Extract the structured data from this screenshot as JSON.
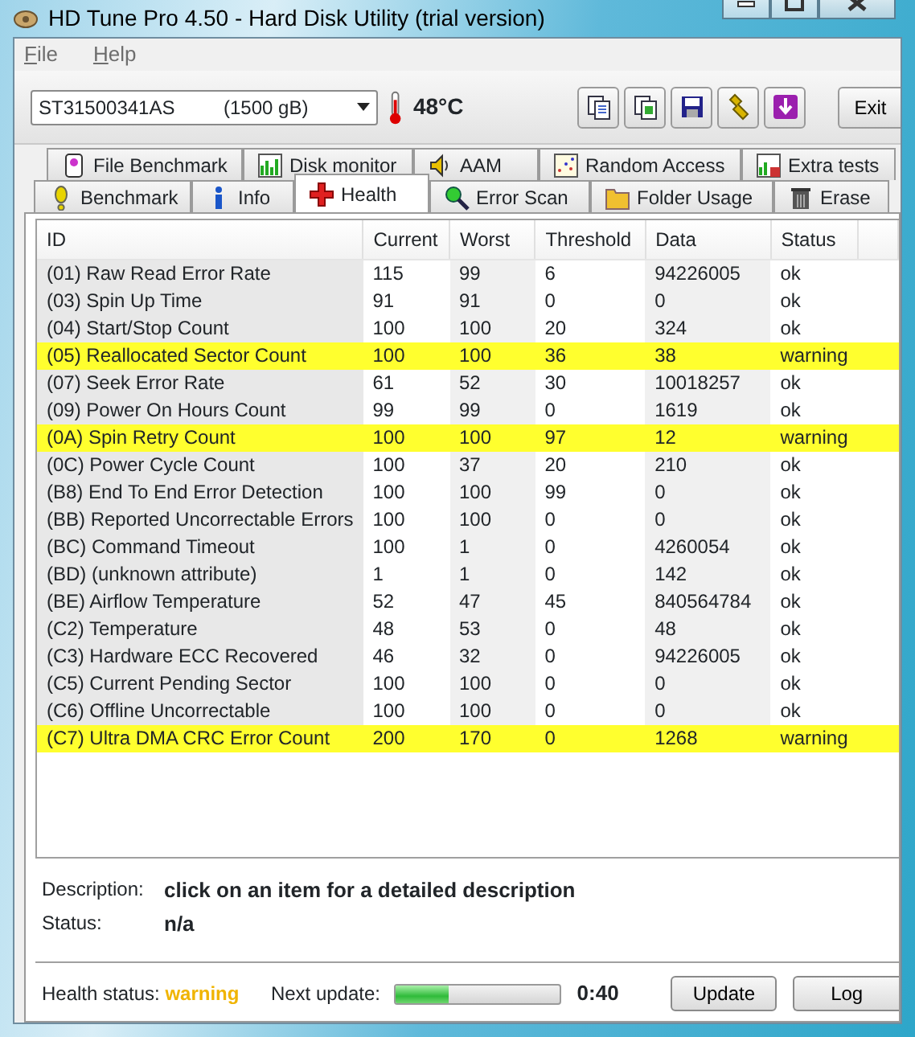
{
  "window": {
    "title": "HD Tune Pro 4.50 - Hard Disk Utility (trial version)"
  },
  "menu": [
    {
      "label": "File"
    },
    {
      "label": "Help"
    }
  ],
  "drive": {
    "model": "ST31500341AS",
    "size": "(1500 gB)"
  },
  "temperature": "48°C",
  "exit_button": "Exit",
  "tab_rows": [
    [
      {
        "label": "File Benchmark",
        "selected": false
      },
      {
        "label": "Disk monitor",
        "selected": false
      },
      {
        "label": "AAM",
        "selected": false
      },
      {
        "label": "Random Access",
        "selected": false
      },
      {
        "label": "Extra tests",
        "selected": false
      }
    ],
    [
      {
        "label": "Benchmark",
        "selected": false
      },
      {
        "label": "Info",
        "selected": false
      },
      {
        "label": "Health",
        "selected": true
      },
      {
        "label": "Error Scan",
        "selected": false
      },
      {
        "label": "Folder Usage",
        "selected": false
      },
      {
        "label": "Erase",
        "selected": false
      }
    ]
  ],
  "table": {
    "columns": [
      "ID",
      "Current",
      "Worst",
      "Threshold",
      "Data",
      "Status"
    ],
    "rows": [
      {
        "cells": [
          "(01) Raw Read Error Rate",
          "115",
          "99",
          "6",
          "94226005",
          "ok"
        ],
        "highlighted": false
      },
      {
        "cells": [
          "(03) Spin Up Time",
          "91",
          "91",
          "0",
          "0",
          "ok"
        ],
        "highlighted": false
      },
      {
        "cells": [
          "(04) Start/Stop Count",
          "100",
          "100",
          "20",
          "324",
          "ok"
        ],
        "highlighted": false
      },
      {
        "cells": [
          "(05) Reallocated Sector Count",
          "100",
          "100",
          "36",
          "38",
          "warning"
        ],
        "highlighted": true
      },
      {
        "cells": [
          "(07) Seek Error Rate",
          "61",
          "52",
          "30",
          "10018257",
          "ok"
        ],
        "highlighted": false
      },
      {
        "cells": [
          "(09) Power On Hours Count",
          "99",
          "99",
          "0",
          "1619",
          "ok"
        ],
        "highlighted": false
      },
      {
        "cells": [
          "(0A) Spin Retry Count",
          "100",
          "100",
          "97",
          "12",
          "warning"
        ],
        "highlighted": true
      },
      {
        "cells": [
          "(0C) Power Cycle Count",
          "100",
          "37",
          "20",
          "210",
          "ok"
        ],
        "highlighted": false
      },
      {
        "cells": [
          "(B8) End To End Error Detection",
          "100",
          "100",
          "99",
          "0",
          "ok"
        ],
        "highlighted": false
      },
      {
        "cells": [
          "(BB) Reported Uncorrectable Errors",
          "100",
          "100",
          "0",
          "0",
          "ok"
        ],
        "highlighted": false
      },
      {
        "cells": [
          "(BC) Command Timeout",
          "100",
          "1",
          "0",
          "4260054",
          "ok"
        ],
        "highlighted": false
      },
      {
        "cells": [
          "(BD) (unknown attribute)",
          "1",
          "1",
          "0",
          "142",
          "ok"
        ],
        "highlighted": false
      },
      {
        "cells": [
          "(BE) Airflow Temperature",
          "52",
          "47",
          "45",
          "840564784",
          "ok"
        ],
        "highlighted": false
      },
      {
        "cells": [
          "(C2) Temperature",
          "48",
          "53",
          "0",
          "48",
          "ok"
        ],
        "highlighted": false
      },
      {
        "cells": [
          "(C3) Hardware ECC Recovered",
          "46",
          "32",
          "0",
          "94226005",
          "ok"
        ],
        "highlighted": false
      },
      {
        "cells": [
          "(C5) Current Pending Sector",
          "100",
          "100",
          "0",
          "0",
          "ok"
        ],
        "highlighted": false
      },
      {
        "cells": [
          "(C6) Offline Uncorrectable",
          "100",
          "100",
          "0",
          "0",
          "ok"
        ],
        "highlighted": false
      },
      {
        "cells": [
          "(C7) Ultra DMA CRC Error Count",
          "200",
          "170",
          "0",
          "1268",
          "warning"
        ],
        "highlighted": true
      }
    ]
  },
  "description": {
    "label": "Description:",
    "value": "click on an item for a detailed description"
  },
  "status": {
    "label": "Status:",
    "value": "n/a"
  },
  "footer": {
    "health_label": "Health status:",
    "health_value": "warning",
    "next_label": "Next update:",
    "level": 0.33,
    "countdown": "0:40",
    "buttons": [
      "Update",
      "Log"
    ]
  }
}
